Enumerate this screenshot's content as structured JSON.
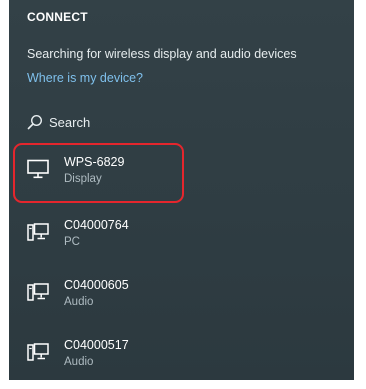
{
  "panel": {
    "title": "CONNECT",
    "status": "Searching for wireless display and audio devices",
    "help_link": "Where is my device?",
    "search_label": "Search"
  },
  "devices": [
    {
      "name": "WPS-6829",
      "kind": "Display",
      "icon": "monitor-icon",
      "highlighted": true
    },
    {
      "name": "C04000764",
      "kind": "PC",
      "icon": "pc-icon"
    },
    {
      "name": "C04000605",
      "kind": "Audio",
      "icon": "pc-icon"
    },
    {
      "name": "C04000517",
      "kind": "Audio",
      "icon": "pc-icon"
    }
  ],
  "colors": {
    "background": "#323f45",
    "link": "#7fc0ec",
    "highlight_border": "#e5262d"
  }
}
